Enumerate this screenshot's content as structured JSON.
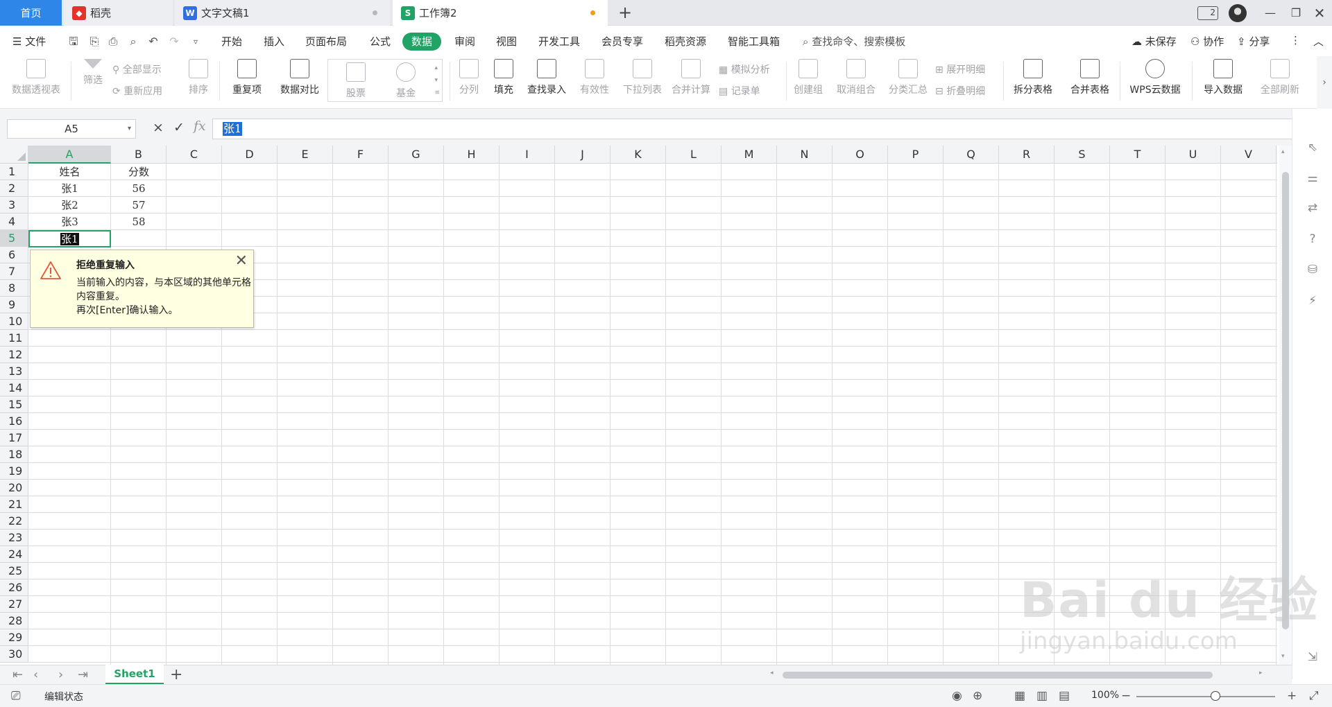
{
  "tabs": {
    "home": "首页",
    "daoke": "稻壳",
    "doc": "文字文稿1",
    "workbook": "工作簿2"
  },
  "window": {
    "badge": "2"
  },
  "menu": {
    "file": "文件",
    "items": [
      "开始",
      "插入",
      "页面布局",
      "公式",
      "数据",
      "审阅",
      "视图",
      "开发工具",
      "会员专享",
      "稻壳资源",
      "智能工具箱"
    ],
    "active": "数据",
    "search": "查找命令、搜索模板",
    "unsaved": "未保存",
    "collab": "协作",
    "share": "分享"
  },
  "ribbon": {
    "pivot": "数据透视表",
    "filter": "筛选",
    "show_all": "全部显示",
    "reapply": "重新应用",
    "sort": "排序",
    "dup": "重复项",
    "compare": "数据对比",
    "stock": "股票",
    "fund": "基金",
    "split": "分列",
    "fill": "填充",
    "lookup": "查找录入",
    "validity": "有效性",
    "dropdown": "下拉列表",
    "consolidate": "合并计算",
    "simulate": "模拟分析",
    "record": "记录单",
    "group": "创建组",
    "ungroup": "取消组合",
    "subtotal": "分类汇总",
    "expand": "展开明细",
    "collapse": "折叠明细",
    "split_table": "拆分表格",
    "merge_table": "合并表格",
    "wps_cloud": "WPS云数据",
    "import": "导入数据",
    "refresh_all": "全部刷新"
  },
  "formula_bar": {
    "name_box": "A5",
    "cancel": "×",
    "confirm": "✓",
    "fx": "fx",
    "value": "张1"
  },
  "columns": [
    "A",
    "B",
    "C",
    "D",
    "E",
    "F",
    "G",
    "H",
    "I",
    "J",
    "K",
    "L",
    "M",
    "N",
    "O",
    "P",
    "Q",
    "R",
    "S",
    "T",
    "U",
    "V"
  ],
  "rows": [
    "1",
    "2",
    "3",
    "4",
    "5",
    "6",
    "7",
    "8",
    "9",
    "10",
    "11",
    "12",
    "13",
    "14",
    "15",
    "16",
    "17",
    "18",
    "19",
    "20",
    "21",
    "22",
    "23",
    "24",
    "25",
    "26",
    "27",
    "28",
    "29",
    "30"
  ],
  "cells": {
    "A1": "姓名",
    "B1": "分数",
    "A2": "张1",
    "B2": "56",
    "A3": "张2",
    "B3": "57",
    "A4": "张3",
    "B4": "58",
    "A5": "张1"
  },
  "active": {
    "col": "A",
    "row": "5"
  },
  "popup": {
    "title": "拒绝重复输入",
    "message": "当前输入的内容，与本区域的其他单元格内容重复。",
    "hint": "再次[Enter]确认输入。"
  },
  "sheets": [
    "Sheet1"
  ],
  "status": {
    "mode": "编辑状态",
    "zoom": "100%"
  },
  "colors": {
    "accent": "#21a366",
    "home_tab": "#2f86e9",
    "popup_bg": "#ffffe1",
    "warn": "#e0563e"
  },
  "watermark": {
    "main": "Bai du 经验",
    "sub": "jingyan.baidu.com"
  }
}
